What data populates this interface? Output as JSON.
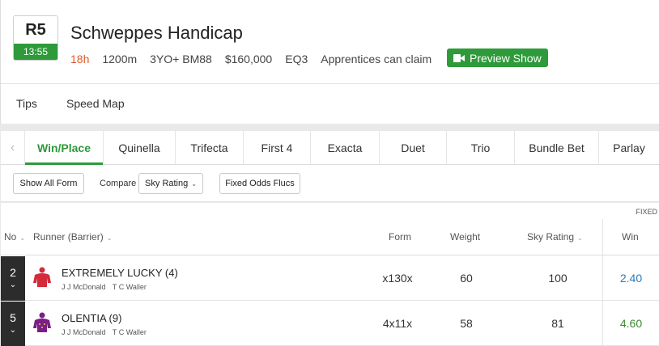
{
  "race": {
    "number": "R5",
    "time": "13:55",
    "title": "Schweppes Handicap",
    "countdown": "18h",
    "distance": "1200m",
    "class": "3YO+ BM88",
    "prize": "$160,000",
    "track": "EQ3",
    "note": "Apprentices can claim",
    "preview_label": "Preview Show"
  },
  "subnav": [
    "Tips",
    "Speed Map"
  ],
  "bet_tabs": [
    "Win/Place",
    "Quinella",
    "Trifecta",
    "First 4",
    "Exacta",
    "Duet",
    "Trio",
    "Bundle Bet",
    "Parlay"
  ],
  "active_tab": "Win/Place",
  "toolbar": {
    "show_all_form": "Show All Form",
    "compare_label": "Compare",
    "compare_value": "Sky Rating",
    "fixed_odds_flucs": "Fixed Odds Flucs"
  },
  "table": {
    "fixed_label": "FIXED",
    "headers": {
      "no": "No",
      "runner": "Runner (Barrier)",
      "form": "Form",
      "weight": "Weight",
      "sky_rating": "Sky Rating",
      "win": "Win"
    },
    "rows": [
      {
        "no": "2",
        "name": "EXTREMELY LUCKY (4)",
        "jockey": "J J McDonald",
        "trainer": "T C Waller",
        "form": "x130x",
        "weight": "60",
        "sky_rating": "100",
        "win": "2.40",
        "win_color": "#2b7bbd",
        "silk_color": "#d42a3a"
      },
      {
        "no": "5",
        "name": "OLENTIA (9)",
        "jockey": "J J McDonald",
        "trainer": "T C Waller",
        "form": "4x11x",
        "weight": "58",
        "sky_rating": "81",
        "win": "4.60",
        "win_color": "#3a8a2e",
        "silk_color": "#7a1f86"
      }
    ]
  }
}
